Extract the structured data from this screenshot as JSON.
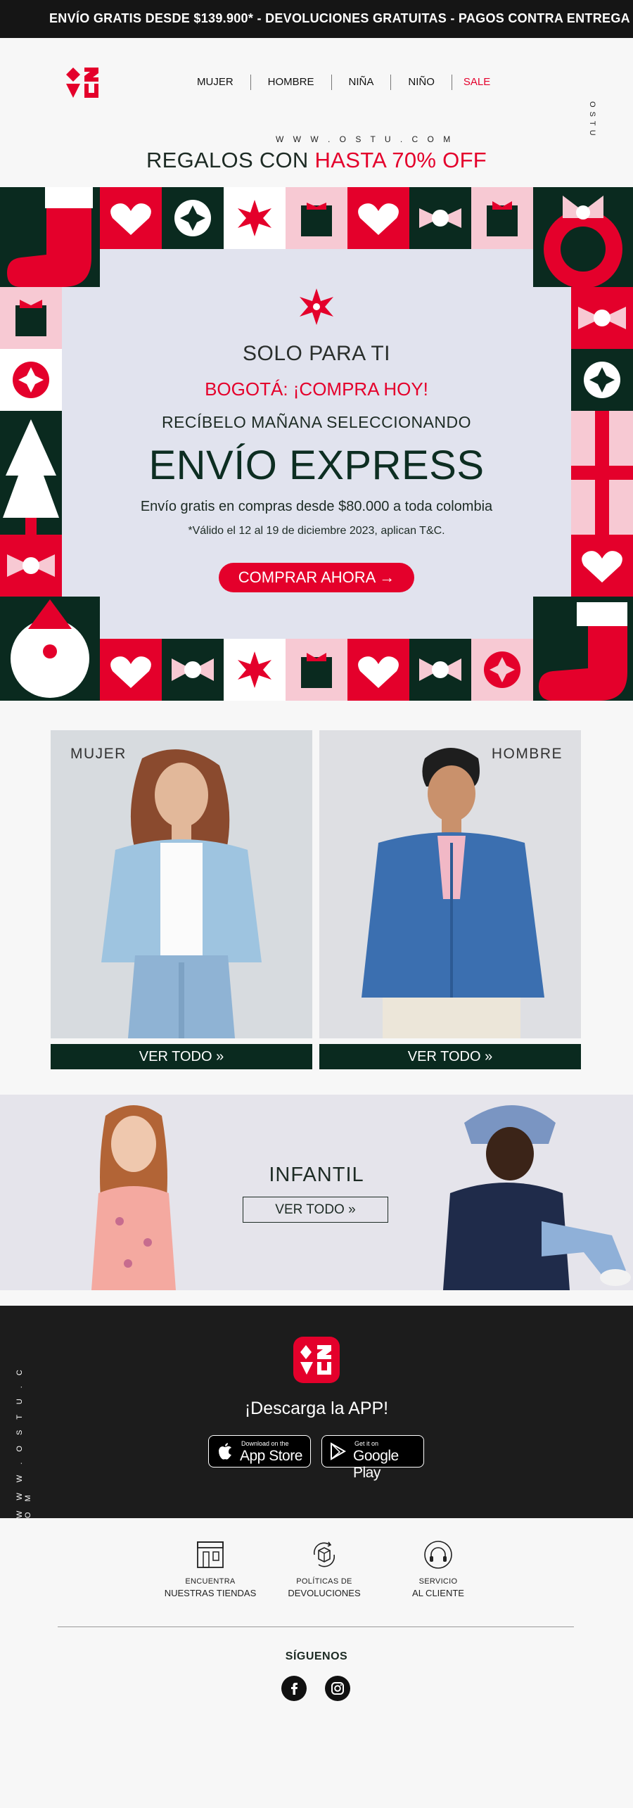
{
  "topbar": {
    "text": "ENVÍO GRATIS DESDE $139.900* - DEVOLUCIONES GRATUITAS - PAGOS CONTRA ENTREGA  - ENVÍ"
  },
  "header": {
    "nav": [
      "MUJER",
      "HOMBRE",
      "NIÑA",
      "NIÑO"
    ],
    "sale": "SALE",
    "site_url": "W W W . O S T U . C O M",
    "side_text": "OSTU"
  },
  "promo": {
    "title_prefix": "REGALOS CON ",
    "title_highlight": "HASTA 70% OFF"
  },
  "banner": {
    "line1": "SOLO PARA TI",
    "line2": "BOGOTÁ: ¡COMPRA HOY!",
    "line3": "RECÍBELO MAÑANA SELECCIONANDO",
    "line4": "ENVÍO EXPRESS",
    "line5": "Envío gratis en compras desde $80.000 a toda colombia",
    "line6": "*Válido el 12 al 19 de diciembre 2023, aplican T&C.",
    "cta": "COMPRAR AHORA →"
  },
  "categories": {
    "women_label": "MUJER",
    "men_label": "HOMBRE",
    "view_all_women": "VER TODO »",
    "view_all_men": "VER TODO »"
  },
  "kids": {
    "title": "INFANTIL",
    "button": "VER TODO »"
  },
  "app": {
    "side_text": "W W W . O S T U . C O M",
    "download": "¡Descarga la APP!",
    "appstore_small": "Download on the",
    "appstore_big": "App Store",
    "googleplay_small": "Get it on",
    "googleplay_big": "Google Play"
  },
  "footer": {
    "services": [
      {
        "small": "ENCUENTRA",
        "big": "NUESTRAS TIENDAS",
        "icon": "store-icon"
      },
      {
        "small": "POLÍTICAS DE",
        "big": "DEVOLUCIONES",
        "icon": "returns-box-icon"
      },
      {
        "small": "SERVICIO",
        "big": "AL CLIENTE",
        "icon": "headset-icon"
      }
    ],
    "follow": "SÍGUENOS",
    "social": [
      "facebook-icon",
      "instagram-icon"
    ]
  },
  "colors": {
    "brand_red": "#e4002b",
    "dark_green": "#0a2a1f",
    "pink": "#f7c9d3",
    "banner_bg": "#e1e3ee"
  }
}
